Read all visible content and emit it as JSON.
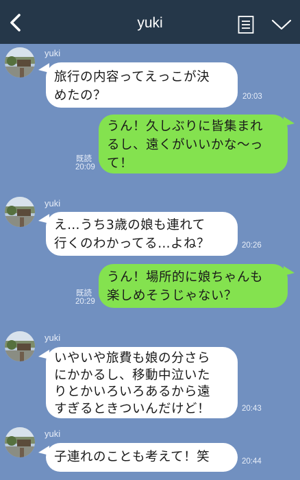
{
  "header": {
    "title": "yuki"
  },
  "messages": [
    {
      "sender": "yuki",
      "line1": "旅行の内容ってえっこが決",
      "line2": "めたの？",
      "time": "20:03"
    },
    {
      "line1": "うん！久しぶりに皆集まれ",
      "line2": "るし、遠くがいいかな〜っ",
      "line3": "て！",
      "read": "既読",
      "time": "20:09"
    },
    {
      "sender": "yuki",
      "line1": "え…うち3歳の娘も連れて",
      "line2": "行くのわかってる…よね？",
      "time": "20:26"
    },
    {
      "line1": "うん！場所的に娘ちゃんも",
      "line2": "楽しめそうじゃない？",
      "read": "既読",
      "time": "20:29"
    },
    {
      "sender": "yuki",
      "line1": "いやいや旅費も娘の分さら",
      "line2": "にかかるし、移動中泣いた",
      "line3": "りとかいろいろあるから遠",
      "line4": "すぎるときついんだけど！",
      "time": "20:43"
    },
    {
      "sender": "yuki",
      "line1": "子連れのことも考えて！笑",
      "time": "20:44"
    }
  ],
  "colors": {
    "background": "#7190c0",
    "header": "#253749",
    "outgoing": "#84e24f",
    "incoming": "#ffffff"
  },
  "icons": [
    "back-chevron-icon",
    "memo-icon",
    "chevron-down-icon"
  ]
}
